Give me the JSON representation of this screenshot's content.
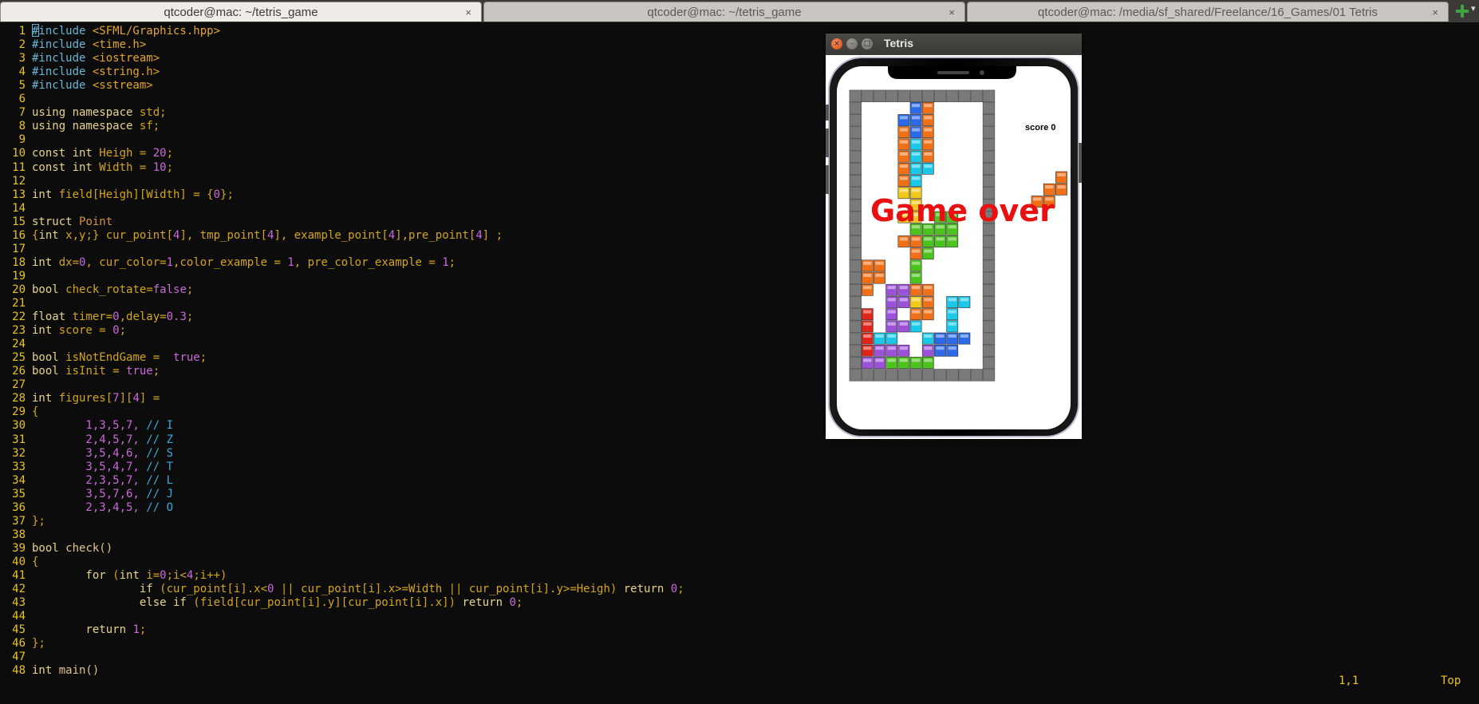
{
  "tabs": [
    {
      "title": "qtcoder@mac: ~/tetris_game",
      "active": true
    },
    {
      "title": "qtcoder@mac: ~/tetris_game",
      "active": false
    },
    {
      "title": "qtcoder@mac: /media/sf_shared/Freelance/16_Games/01 Tetris",
      "active": false
    }
  ],
  "tab_close_glyph": "×",
  "new_tab_icon": "plus-icon",
  "tab_menu_icon": "▾",
  "code_lines": [
    {
      "n": "1",
      "tokens": [
        [
          "#include ",
          "p"
        ],
        [
          "<SFML/Graphics.hpp>",
          "s"
        ]
      ]
    },
    {
      "n": "2",
      "tokens": [
        [
          "#include ",
          "p"
        ],
        [
          "<time.h>",
          "s"
        ]
      ]
    },
    {
      "n": "3",
      "tokens": [
        [
          "#include ",
          "p"
        ],
        [
          "<iostream>",
          "s"
        ]
      ]
    },
    {
      "n": "4",
      "tokens": [
        [
          "#include ",
          "p"
        ],
        [
          "<string.h>",
          "s"
        ]
      ]
    },
    {
      "n": "5",
      "tokens": [
        [
          "#include ",
          "p"
        ],
        [
          "<sstream>",
          "s"
        ]
      ]
    },
    {
      "n": "6",
      "tokens": []
    },
    {
      "n": "7",
      "tokens": [
        [
          "using namespace ",
          "k"
        ],
        [
          "std;",
          "o"
        ]
      ]
    },
    {
      "n": "8",
      "tokens": [
        [
          "using namespace ",
          "k"
        ],
        [
          "sf;",
          "o"
        ]
      ]
    },
    {
      "n": "9",
      "tokens": []
    },
    {
      "n": "10",
      "tokens": [
        [
          "const int ",
          "k"
        ],
        [
          "Heigh ",
          "o"
        ],
        [
          "= ",
          "o"
        ],
        [
          "20",
          "n"
        ],
        [
          ";",
          "o"
        ]
      ]
    },
    {
      "n": "11",
      "tokens": [
        [
          "const int ",
          "k"
        ],
        [
          "Width ",
          "o"
        ],
        [
          "= ",
          "o"
        ],
        [
          "10",
          "n"
        ],
        [
          ";",
          "o"
        ]
      ]
    },
    {
      "n": "12",
      "tokens": []
    },
    {
      "n": "13",
      "tokens": [
        [
          "int ",
          "k"
        ],
        [
          "field[Heigh][Width] = {",
          "o"
        ],
        [
          "0",
          "n"
        ],
        [
          "};",
          "o"
        ]
      ]
    },
    {
      "n": "14",
      "tokens": []
    },
    {
      "n": "15",
      "tokens": [
        [
          "struct ",
          "k"
        ],
        [
          "Point",
          "v"
        ]
      ]
    },
    {
      "n": "16",
      "tokens": [
        [
          "{",
          "o"
        ],
        [
          "int ",
          "k"
        ],
        [
          "x,y;} cur_point[",
          "o"
        ],
        [
          "4",
          "n"
        ],
        [
          "], tmp_point[",
          "o"
        ],
        [
          "4",
          "n"
        ],
        [
          "], example_point[",
          "o"
        ],
        [
          "4",
          "n"
        ],
        [
          "],pre_point[",
          "o"
        ],
        [
          "4",
          "n"
        ],
        [
          "] ;",
          "o"
        ]
      ]
    },
    {
      "n": "17",
      "tokens": []
    },
    {
      "n": "18",
      "tokens": [
        [
          "int ",
          "k"
        ],
        [
          "dx=",
          "o"
        ],
        [
          "0",
          "n"
        ],
        [
          ", cur_color=",
          "o"
        ],
        [
          "1",
          "n"
        ],
        [
          ",color_example = ",
          "o"
        ],
        [
          "1",
          "n"
        ],
        [
          ", pre_color_example = ",
          "o"
        ],
        [
          "1",
          "n"
        ],
        [
          ";",
          "o"
        ]
      ]
    },
    {
      "n": "19",
      "tokens": []
    },
    {
      "n": "20",
      "tokens": [
        [
          "bool ",
          "k"
        ],
        [
          "check_rotate=",
          "o"
        ],
        [
          "false",
          "n"
        ],
        [
          ";",
          "o"
        ]
      ]
    },
    {
      "n": "21",
      "tokens": []
    },
    {
      "n": "22",
      "tokens": [
        [
          "float ",
          "k"
        ],
        [
          "timer=",
          "o"
        ],
        [
          "0",
          "n"
        ],
        [
          ",delay=",
          "o"
        ],
        [
          "0.3",
          "n"
        ],
        [
          ";",
          "o"
        ]
      ]
    },
    {
      "n": "23",
      "tokens": [
        [
          "int ",
          "k"
        ],
        [
          "score = ",
          "o"
        ],
        [
          "0",
          "n"
        ],
        [
          ";",
          "o"
        ]
      ]
    },
    {
      "n": "24",
      "tokens": []
    },
    {
      "n": "25",
      "tokens": [
        [
          "bool ",
          "k"
        ],
        [
          "isNotEndGame =  ",
          "o"
        ],
        [
          "true",
          "n"
        ],
        [
          ";",
          "o"
        ]
      ]
    },
    {
      "n": "26",
      "tokens": [
        [
          "bool ",
          "k"
        ],
        [
          "isInit = ",
          "o"
        ],
        [
          "true",
          "n"
        ],
        [
          ";",
          "o"
        ]
      ]
    },
    {
      "n": "27",
      "tokens": []
    },
    {
      "n": "28",
      "tokens": [
        [
          "int ",
          "k"
        ],
        [
          "figures[",
          "o"
        ],
        [
          "7",
          "n"
        ],
        [
          "][",
          "o"
        ],
        [
          "4",
          "n"
        ],
        [
          "] =",
          "o"
        ]
      ]
    },
    {
      "n": "29",
      "tokens": [
        [
          "{",
          "o"
        ]
      ]
    },
    {
      "n": "30",
      "tokens": [
        [
          "        1,3,5,7, ",
          "n"
        ],
        [
          "// I",
          "c"
        ]
      ]
    },
    {
      "n": "31",
      "tokens": [
        [
          "        2,4,5,7, ",
          "n"
        ],
        [
          "// Z",
          "c"
        ]
      ]
    },
    {
      "n": "32",
      "tokens": [
        [
          "        3,5,4,6, ",
          "n"
        ],
        [
          "// S",
          "c"
        ]
      ]
    },
    {
      "n": "33",
      "tokens": [
        [
          "        3,5,4,7, ",
          "n"
        ],
        [
          "// T",
          "c"
        ]
      ]
    },
    {
      "n": "34",
      "tokens": [
        [
          "        2,3,5,7, ",
          "n"
        ],
        [
          "// L",
          "c"
        ]
      ]
    },
    {
      "n": "35",
      "tokens": [
        [
          "        3,5,7,6, ",
          "n"
        ],
        [
          "// J",
          "c"
        ]
      ]
    },
    {
      "n": "36",
      "tokens": [
        [
          "        2,3,4,5, ",
          "n"
        ],
        [
          "// O",
          "c"
        ]
      ]
    },
    {
      "n": "37",
      "tokens": [
        [
          "};",
          "o"
        ]
      ]
    },
    {
      "n": "38",
      "tokens": []
    },
    {
      "n": "39",
      "tokens": [
        [
          "bool ",
          "k"
        ],
        [
          "check()",
          "f"
        ]
      ]
    },
    {
      "n": "40",
      "tokens": [
        [
          "{",
          "o"
        ]
      ]
    },
    {
      "n": "41",
      "tokens": [
        [
          "        for ",
          "k"
        ],
        [
          "(",
          "o"
        ],
        [
          "int ",
          "k"
        ],
        [
          "i=",
          "o"
        ],
        [
          "0",
          "n"
        ],
        [
          ";i<",
          "o"
        ],
        [
          "4",
          "n"
        ],
        [
          ";i++)",
          "o"
        ]
      ]
    },
    {
      "n": "42",
      "tokens": [
        [
          "                if ",
          "k"
        ],
        [
          "(cur_point[i].x<",
          "o"
        ],
        [
          "0",
          "n"
        ],
        [
          " || cur_point[i].x>=Width || cur_point[i].y>=Heigh) ",
          "o"
        ],
        [
          "return ",
          "k"
        ],
        [
          "0",
          "n"
        ],
        [
          ";",
          "o"
        ]
      ]
    },
    {
      "n": "43",
      "tokens": [
        [
          "                else if ",
          "k"
        ],
        [
          "(field[cur_point[i].y][cur_point[i].x]) ",
          "o"
        ],
        [
          "return ",
          "k"
        ],
        [
          "0",
          "n"
        ],
        [
          ";",
          "o"
        ]
      ]
    },
    {
      "n": "44",
      "tokens": []
    },
    {
      "n": "45",
      "tokens": [
        [
          "        return ",
          "k"
        ],
        [
          "1",
          "n"
        ],
        [
          ";",
          "o"
        ]
      ]
    },
    {
      "n": "46",
      "tokens": [
        [
          "};",
          "o"
        ]
      ]
    },
    {
      "n": "47",
      "tokens": []
    },
    {
      "n": "48",
      "tokens": [
        [
          "int ",
          "k"
        ],
        [
          "main()",
          "f"
        ]
      ]
    }
  ],
  "status": {
    "position": "1,1",
    "scroll": "Top"
  },
  "tetris": {
    "window_title": "Tetris",
    "close_glyph": "×",
    "minimize_glyph": "–",
    "maximize_glyph": "□",
    "score_text": "score 0",
    "game_over_text": "Game over",
    "field_rows": 20,
    "field_cols": 10,
    "colors": {
      "r": "#e0261c",
      "o": "#f07018",
      "y": "#f0c81c",
      "g": "#4cc21c",
      "c": "#1cc8e8",
      "b": "#2c6ae8",
      "p": "#9c52d8",
      "frame": "#7a7a7a",
      "frame_dark": "#5a5a5a",
      "game_over": "#e81010"
    },
    "board": [
      "....bo....",
      "...bbo....",
      "...obo....",
      "...oco....",
      "...oco....",
      "...occ....",
      "...oc.....",
      "...yy.....",
      "....y.....",
      "...yy.gg..",
      "....gggg..",
      "...ooggg..",
      "....og....",
      "oo..g.....",
      "oo..g.....",
      "o.ppoo....",
      "..ppyo.cc.",
      "r.p.oo.c..",
      "r.ppc..c..",
      "rcc..cbbb.",
      "rppp.pbb..",
      "ppgggg...."
    ],
    "next_piece": [
      "..o",
      ".oo",
      "oo."
    ]
  }
}
